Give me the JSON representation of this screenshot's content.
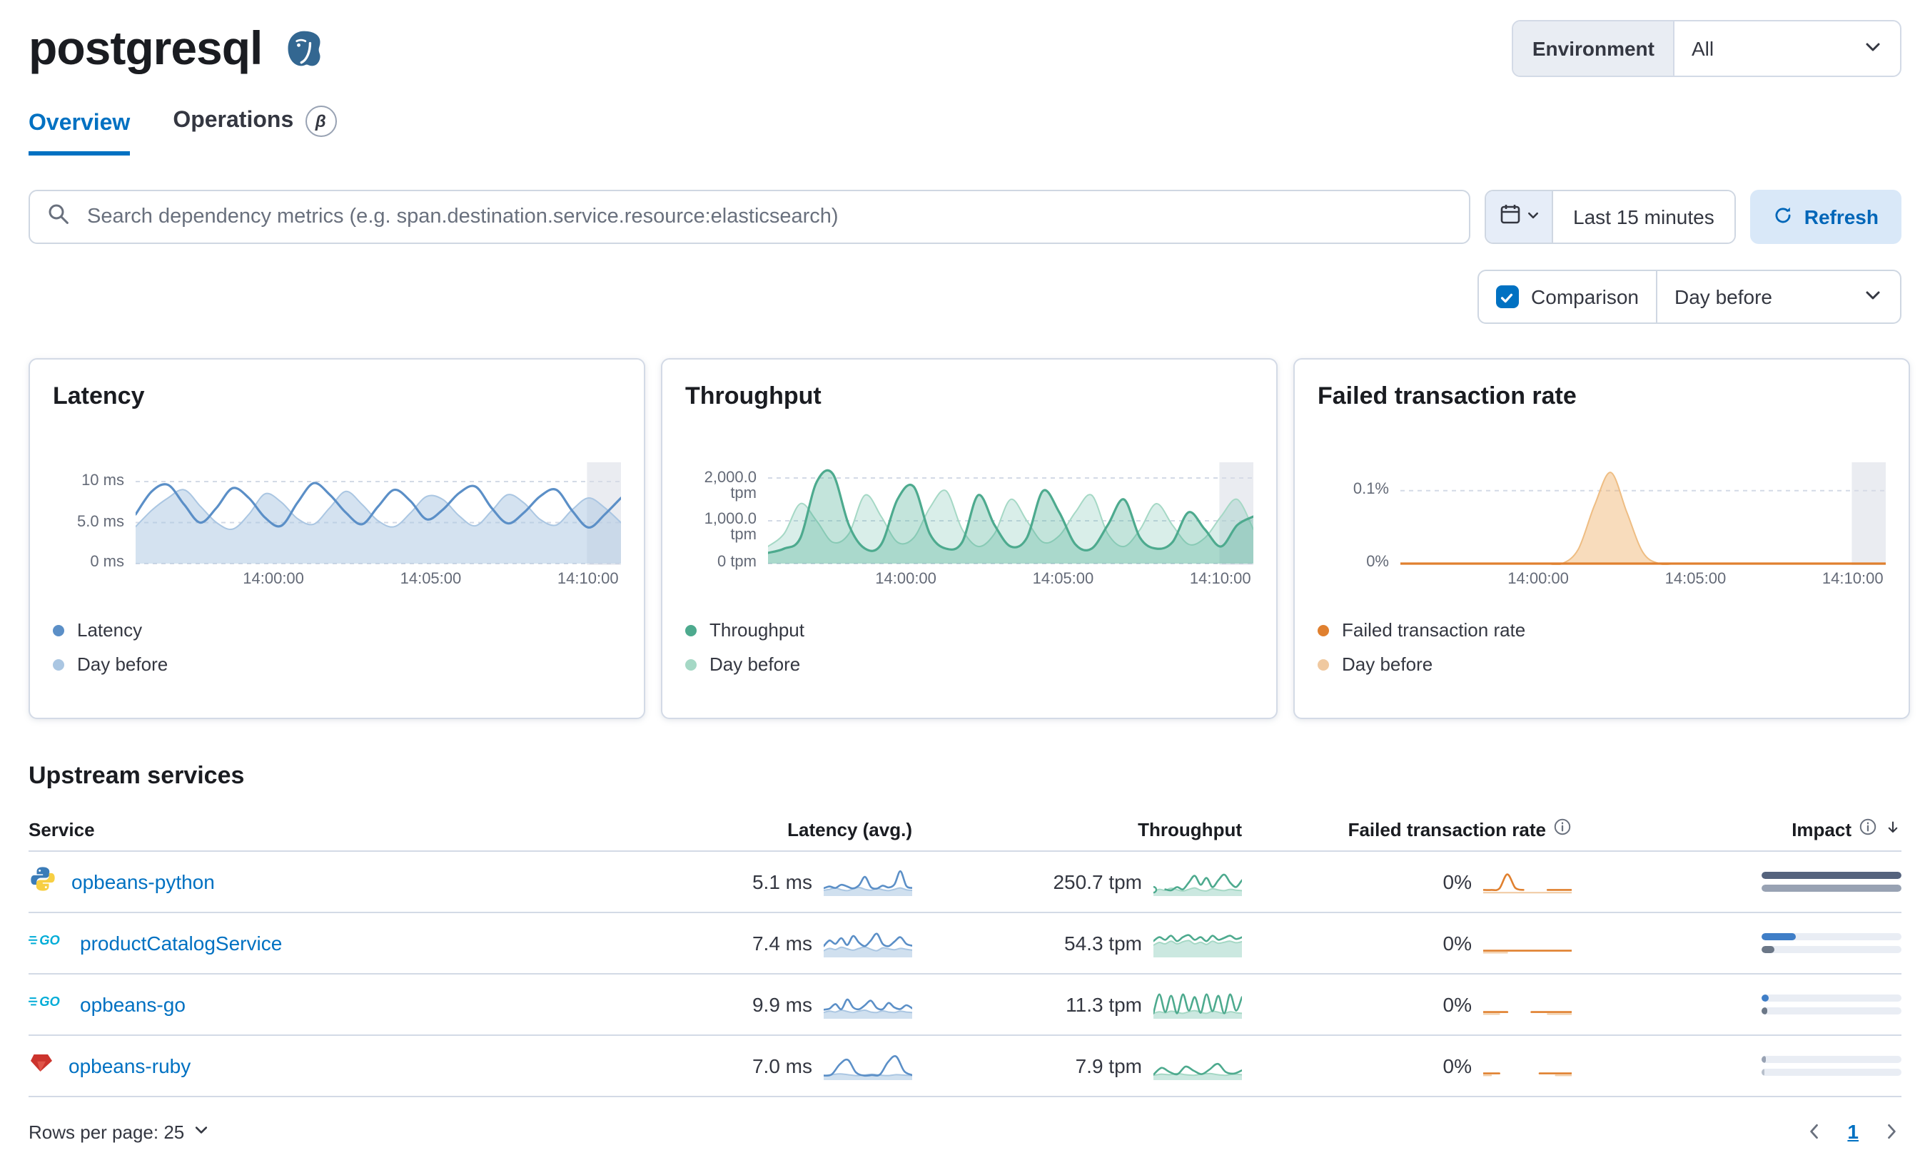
{
  "header": {
    "title": "postgresql",
    "environment": {
      "label": "Environment",
      "value": "All"
    }
  },
  "tabs": {
    "overview": "Overview",
    "operations": "Operations",
    "beta": "β"
  },
  "toolbar": {
    "search_placeholder": "Search dependency metrics (e.g. span.destination.service.resource:elasticsearch)",
    "time_range": "Last 15 minutes",
    "refresh": "Refresh",
    "comparison_label": "Comparison",
    "comparison_value": "Day before"
  },
  "cards": [
    {
      "title": "Latency",
      "legend": [
        {
          "label": "Latency",
          "color": "#5b8fc7"
        },
        {
          "label": "Day before",
          "color": "#aac6e2"
        }
      ]
    },
    {
      "title": "Throughput",
      "legend": [
        {
          "label": "Throughput",
          "color": "#4daa8e"
        },
        {
          "label": "Day before",
          "color": "#a5d8c5"
        }
      ]
    },
    {
      "title": "Failed transaction rate",
      "legend": [
        {
          "label": "Failed transaction rate",
          "color": "#e0802f"
        },
        {
          "label": "Day before",
          "color": "#f0c9a0"
        }
      ]
    }
  ],
  "chart_data": {
    "xticks": [
      "14:00:00",
      "14:05:00",
      "14:10:00"
    ],
    "latency": {
      "type": "line",
      "title": "Latency",
      "ymax": 12,
      "grid": [
        0,
        5,
        10
      ],
      "band": [
        0.93,
        1
      ],
      "yticks": [
        "10 ms",
        "5.0 ms",
        "0 ms"
      ],
      "series": [
        {
          "name": "Day before",
          "fill": "rgba(170,198,226,0.5)",
          "color": "#aac6e2",
          "width": 1,
          "values": [
            4.5,
            6.5,
            8,
            9,
            7,
            5,
            4.2,
            6,
            8.5,
            7.5,
            5.5,
            4.8,
            6.8,
            8.8,
            7.2,
            5.2,
            4.5,
            6.2,
            8.2,
            7.8,
            5.8,
            4.6,
            6.4,
            8.4,
            7.4,
            5.4,
            4.7,
            6.6,
            8,
            6.8,
            5
          ]
        },
        {
          "name": "Latency",
          "color": "#5b8fc7",
          "width": 1.6,
          "values": [
            6,
            8.8,
            9.6,
            7.2,
            5,
            6.8,
            9.2,
            8,
            5.6,
            4.6,
            7.4,
            9.8,
            8.4,
            6.2,
            4.8,
            7,
            9,
            7.6,
            5.4,
            6.6,
            8.6,
            9.4,
            6.8,
            4.9,
            6.2,
            8.2,
            9,
            6.4,
            4.4,
            6,
            8
          ]
        }
      ]
    },
    "throughput": {
      "type": "area",
      "title": "Throughput",
      "ymax": 2300,
      "grid": [
        0,
        1000,
        2000
      ],
      "band": [
        0.93,
        1
      ],
      "yticks": [
        "2,000.0 tpm",
        "1,000.0 tpm",
        "0 tpm"
      ],
      "series": [
        {
          "name": "Day before",
          "fill": "rgba(84,179,153,0.22)",
          "color": "#a5d8c5",
          "width": 1,
          "values": [
            400,
            700,
            1400,
            1000,
            500,
            700,
            1600,
            1100,
            500,
            600,
            1300,
            1700,
            800,
            400,
            700,
            1500,
            1000,
            500,
            650,
            1200,
            1600,
            700,
            400,
            800,
            1400,
            900,
            450,
            600,
            1100,
            1500,
            800
          ]
        },
        {
          "name": "Throughput",
          "fill": "rgba(84,179,153,0.35)",
          "color": "#4daa8e",
          "width": 1.6,
          "values": [
            250,
            350,
            600,
            1900,
            2100,
            900,
            350,
            450,
            1500,
            1800,
            700,
            350,
            500,
            1600,
            900,
            400,
            600,
            1700,
            1200,
            450,
            350,
            900,
            1500,
            600,
            350,
            500,
            1200,
            800,
            400,
            900,
            1100
          ]
        }
      ]
    },
    "failed_rate": {
      "type": "line",
      "title": "Failed transaction rate",
      "ymax": 0.135,
      "grid": [
        0,
        0.1
      ],
      "band": [
        0.93,
        1
      ],
      "yticks": [
        "0.1%",
        "0%"
      ],
      "series": [
        {
          "name": "Day before",
          "fill": "rgba(240,178,107,0.45)",
          "color": "#eebd83",
          "width": 1,
          "values": [
            0,
            0,
            0,
            0,
            0,
            0,
            0,
            0,
            0,
            0,
            0,
            0.02,
            0.08,
            0.125,
            0.07,
            0.015,
            0,
            0,
            0,
            0,
            0,
            0,
            0,
            0,
            0,
            0,
            0,
            0,
            0,
            0,
            0
          ]
        },
        {
          "name": "Failed transaction rate",
          "color": "#e0802f",
          "width": 1.6,
          "values": [
            0,
            0,
            0,
            0,
            0,
            0,
            0,
            0,
            0,
            0,
            0,
            0,
            0,
            0,
            0,
            0,
            0,
            0,
            0,
            0,
            0,
            0,
            0,
            0,
            0,
            0,
            0,
            0,
            0,
            0,
            0
          ]
        }
      ]
    }
  },
  "upstream": {
    "title": "Upstream services",
    "headers": {
      "service": "Service",
      "latency": "Latency (avg.)",
      "throughput": "Throughput",
      "failed": "Failed transaction rate",
      "impact": "Impact"
    }
  },
  "table": {
    "rows": [
      {
        "name": "opbeans-python",
        "icon": "python",
        "latency": "5.1 ms",
        "throughput": "250.7 tpm",
        "failed": "0%",
        "latency_spark": {
          "ymax": 12,
          "series": [
            {
              "fill": "rgba(170,198,226,0.55)",
              "color": "#aac6e2",
              "width": 1,
              "values": [
                2.5,
                3,
                3.6,
                2.8,
                2.4,
                3.2,
                3.8,
                3,
                2.6,
                3.4,
                2.8,
                2.4,
                3,
                3.6,
                2.8,
                2.5
              ]
            },
            {
              "color": "#5b8fc7",
              "width": 1.3,
              "values": [
                3.5,
                4.2,
                3.6,
                5,
                4.2,
                3.4,
                4.8,
                8.5,
                4,
                3.3,
                4.6,
                3.8,
                5.2,
                11,
                4.5,
                3.6
              ]
            }
          ]
        },
        "throughput_spark": {
          "ymax": 12,
          "series": [
            {
              "fill": "rgba(84,179,153,0.3)",
              "color": "#a5d8c5",
              "width": 1,
              "values": [
                2,
                3,
                2.5,
                3.5,
                2.8,
                2.2,
                3,
                3.6,
                2.6,
                2.3,
                3.2,
                2.7,
                2.4,
                3,
                2.6,
                2.4
              ]
            },
            {
              "color": "#4daa8e",
              "width": 1.3,
              "values": [
                2.8,
                null,
                3,
                2.5,
                4,
                3,
                6,
                9,
                5,
                8,
                4,
                7,
                9.5,
                6,
                4,
                7
              ]
            }
          ]
        },
        "failed_spark": {
          "ymax": 2,
          "series": [
            {
              "color": "#f0c9a0",
              "width": 1,
              "values": [
                0.25,
                0.25,
                0.25,
                0.25,
                0.25,
                0.25,
                0.25,
                0.25,
                0.25,
                0.25,
                0.25,
                0.25
              ]
            },
            {
              "color": "#e0802f",
              "width": 1.3,
              "values": [
                0.45,
                0.45,
                0.55,
                1.6,
                0.6,
                0.45,
                null,
                null,
                0.45,
                0.45,
                0.45,
                0.45
              ]
            }
          ]
        },
        "impact": {
          "cur": {
            "pct": 100,
            "color": "#55637d"
          },
          "prev": {
            "pct": 100,
            "color": "#98a2b3"
          }
        }
      },
      {
        "name": "productCatalogService",
        "icon": "go",
        "latency": "7.4 ms",
        "throughput": "54.3 tpm",
        "failed": "0%",
        "latency_spark": {
          "ymax": 12,
          "series": [
            {
              "fill": "rgba(170,198,226,0.55)",
              "color": "#aac6e2",
              "width": 1,
              "values": [
                3,
                4,
                3.5,
                4.5,
                3.8,
                3.2,
                4,
                4.6,
                3.6,
                3,
                4.2,
                3.8,
                3.4,
                4,
                3.6,
                3.2
              ]
            },
            {
              "color": "#5b8fc7",
              "width": 1.3,
              "values": [
                5,
                7.5,
                6,
                8.5,
                5.5,
                9.5,
                6.5,
                5,
                7.5,
                10.5,
                6,
                5,
                7,
                9,
                6,
                5.2
              ]
            }
          ]
        },
        "throughput_spark": {
          "ymax": 10,
          "series": [
            {
              "fill": "rgba(84,179,153,0.3)",
              "color": "#a5d8c5",
              "width": 1,
              "values": [
                4.5,
                5.5,
                5,
                6,
                5,
                5.8,
                6.2,
                5,
                5.6,
                4.8,
                6,
                5.2,
                5.6,
                6,
                5.4,
                5.8
              ]
            },
            {
              "color": "#4daa8e",
              "width": 1.3,
              "values": [
                6,
                7.5,
                6.5,
                8,
                6,
                7.5,
                8.2,
                6.5,
                7.5,
                6,
                8,
                6.5,
                7.2,
                8,
                6.8,
                7.4
              ]
            }
          ]
        },
        "failed_spark": {
          "ymax": 2,
          "series": [
            {
              "color": "#f0c9a0",
              "width": 1,
              "values": [
                0.35,
                0.35,
                0.35,
                0.35,
                null,
                null,
                null,
                null,
                null,
                null,
                null,
                null
              ]
            },
            {
              "color": "#e0802f",
              "width": 1.3,
              "values": [
                0.5,
                0.5,
                0.5,
                0.5,
                0.5,
                0.5,
                0.5,
                0.5,
                0.5,
                0.5,
                0.5,
                0.5
              ]
            }
          ]
        },
        "impact": {
          "cur": {
            "pct": 24,
            "color": "#3f7ec7"
          },
          "prev": {
            "pct": 9,
            "color": "#6b7787"
          }
        }
      },
      {
        "name": "opbeans-go",
        "icon": "go",
        "latency": "9.9 ms",
        "throughput": "11.3 tpm",
        "failed": "0%",
        "latency_spark": {
          "ymax": 12,
          "series": [
            {
              "fill": "rgba(170,198,226,0.55)",
              "color": "#aac6e2",
              "width": 1,
              "values": [
                2.8,
                3.4,
                3,
                3.8,
                3.2,
                2.8,
                3.4,
                3.8,
                3,
                2.8,
                3.5,
                3,
                2.8,
                3.4,
                3,
                2.8
              ]
            },
            {
              "color": "#5b8fc7",
              "width": 1.3,
              "values": [
                4,
                4.5,
                6.5,
                4.2,
                8.5,
                5,
                4.2,
                6,
                8,
                4.8,
                4.2,
                7,
                5,
                4.3,
                6,
                4.6
              ]
            }
          ]
        },
        "throughput_spark": {
          "ymax": 10,
          "series": [
            {
              "fill": "rgba(84,179,153,0.3)",
              "color": "#a5d8c5",
              "width": 1,
              "values": [
                2,
                2.6,
                2.2,
                2.8,
                2.4,
                2,
                2.6,
                3,
                2.4,
                2,
                2.8,
                2.4,
                2,
                2.6,
                2.2,
                2
              ]
            },
            {
              "color": "#4daa8e",
              "width": 1.3,
              "values": [
                2,
                9,
                2.5,
                8.5,
                2,
                9,
                3,
                8,
                2.2,
                9,
                2.8,
                8.5,
                2,
                9,
                3,
                8
              ]
            }
          ]
        },
        "failed_spark": {
          "ymax": 2,
          "series": [
            {
              "color": "#f0c9a0",
              "width": 1,
              "values": [
                0.35,
                0.35,
                0.35,
                null,
                null,
                null,
                null,
                null,
                0.35,
                0.35,
                0.35,
                0.35
              ]
            },
            {
              "color": "#e0802f",
              "width": 1.3,
              "values": [
                0.5,
                0.5,
                0.5,
                0.5,
                null,
                null,
                0.5,
                0.5,
                0.5,
                0.5,
                0.5,
                0.5
              ]
            }
          ]
        },
        "impact": {
          "cur": {
            "pct": 5,
            "color": "#3f7ec7"
          },
          "prev": {
            "pct": 4,
            "color": "#6b7787"
          }
        }
      },
      {
        "name": "opbeans-ruby",
        "icon": "ruby",
        "latency": "7.0 ms",
        "throughput": "7.9 tpm",
        "failed": "0%",
        "latency_spark": {
          "ymax": 12,
          "series": [
            {
              "fill": "rgba(170,198,226,0.55)",
              "color": "#aac6e2",
              "width": 1,
              "values": [
                2,
                2.4,
                2.8,
                2.4,
                2,
                2.2,
                2.6,
                2.2,
                2,
                2.4,
                2.2,
                2
              ]
            },
            {
              "color": "#5b8fc7",
              "width": 1.3,
              "values": [
                2,
                2.5,
                7,
                9,
                3.5,
                2,
                2.2,
                2.5,
                8,
                10.5,
                4,
                2.2
              ]
            }
          ]
        },
        "throughput_spark": {
          "ymax": 10,
          "series": [
            {
              "fill": "rgba(84,179,153,0.3)",
              "color": "#a5d8c5",
              "width": 1,
              "values": [
                1.8,
                2.2,
                2,
                2.4,
                2,
                1.8,
                2.2,
                2.4,
                2,
                1.8,
                2.2,
                2
              ]
            },
            {
              "color": "#4daa8e",
              "width": 1.3,
              "values": [
                2,
                4.5,
                3,
                2.2,
                5,
                3.5,
                2.2,
                4,
                6,
                3,
                2.4,
                3.6
              ]
            }
          ]
        },
        "failed_spark": {
          "ymax": 2,
          "series": [
            {
              "color": "#f0c9a0",
              "width": 1,
              "values": [
                0.35,
                0.35,
                null,
                null,
                null,
                null,
                null,
                null,
                null,
                0.35,
                0.35,
                0.35
              ]
            },
            {
              "color": "#e0802f",
              "width": 1.3,
              "values": [
                0.5,
                0.5,
                0.5,
                null,
                null,
                null,
                null,
                0.5,
                0.5,
                0.5,
                0.5,
                0.5
              ]
            }
          ]
        },
        "impact": {
          "cur": {
            "pct": 3,
            "color": "#98a2b3"
          },
          "prev": {
            "pct": 2,
            "color": "#b7bfcb"
          }
        }
      }
    ]
  },
  "footer": {
    "rows_per_page": "Rows per page: 25",
    "page": "1"
  }
}
